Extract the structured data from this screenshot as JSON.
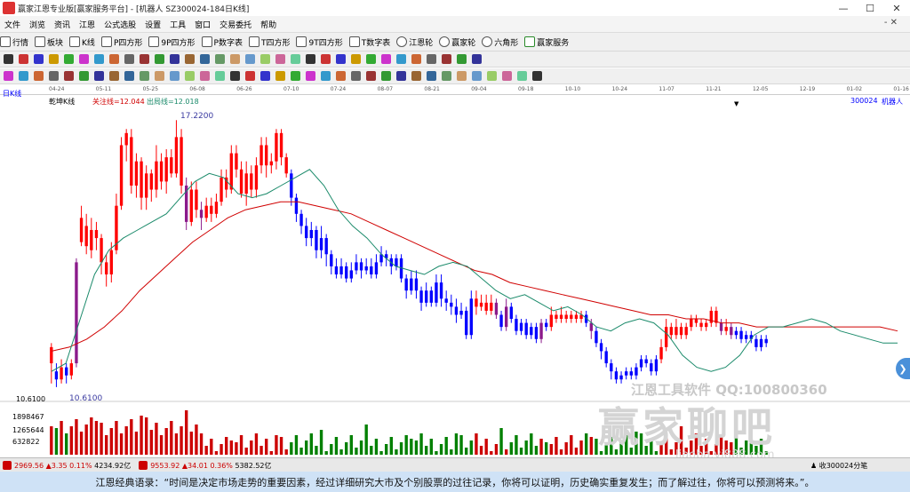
{
  "window": {
    "title": "赢家江恩专业版[赢家服务平台] - [机器人  SZ300024-184日K线]",
    "btn_min": "—",
    "btn_max": "☐",
    "btn_close": "✕"
  },
  "menu": {
    "items": [
      "文件",
      "浏览",
      "资讯",
      "江恩",
      "公式选股",
      "设置",
      "工具",
      "窗口",
      "交易委托",
      "帮助"
    ],
    "close_label": "- ✕"
  },
  "toolbar1": {
    "items": [
      "行情",
      "板块",
      "K线",
      "P四方形",
      "9P四方形",
      "P数字表",
      "T四方形",
      "9T四方形",
      "T数字表",
      "江恩轮",
      "赢家轮",
      "六角形",
      "赢家服务"
    ]
  },
  "date_axis": {
    "labels": [
      "04-24",
      "05-11",
      "05-25",
      "06-08",
      "06-26",
      "07-10",
      "07-24",
      "08-07",
      "08-21",
      "09-04",
      "09-18",
      "10-10",
      "10-24",
      "11-07",
      "11-21",
      "12-05",
      "12-19",
      "01-02",
      "01-16"
    ]
  },
  "chart_header": {
    "period": "日K线",
    "indicator": "乾坤K线",
    "line1": "关注线=12.044",
    "line2": "出局线=12.018",
    "stock": "300024",
    "stock_name": "机器人"
  },
  "price_labels": {
    "high": "17.2200",
    "low": "10.6100",
    "axis_low": "10.6100"
  },
  "volume_axis": {
    "labels": [
      "1898467",
      "1265644",
      "632822"
    ]
  },
  "statusbar": {
    "idx1_value": "2969.56",
    "idx1_change": "▲3.35",
    "idx1_pct": "0.11%",
    "idx1_amount": "4234.92亿",
    "idx2_value": "9553.92",
    "idx2_change": "▲34.01",
    "idx2_pct": "0.36%",
    "idx2_amount": "5382.52亿",
    "right_text": "收300024分笔"
  },
  "watermark": {
    "line1": "江恩工具软件  QQ:100800360",
    "line2": "赢家聊吧",
    "line3": "liaoba.yj888.com"
  },
  "bottom_quote": "江恩经典语录：“时间是决定市场走势的重要因素，经过详细研究大市及个别股票的过往记录，你将可以证明，历史确实重复发生；而了解过往，你将可以预测将来。”。",
  "colors": {
    "up": "#ff0000",
    "down": "#0000ff",
    "special": "#8b1a8b",
    "ma_red": "#d00000",
    "ma_green": "#1a8a6a",
    "vol_up": "#cc0000",
    "vol_down": "#008000"
  },
  "chart_data": {
    "type": "candlestick",
    "ylim": [
      10.3,
      17.6
    ],
    "candles": [
      {
        "o": 11.2,
        "c": 11.6,
        "h": 11.7,
        "l": 10.7,
        "t": "up"
      },
      {
        "o": 11.0,
        "c": 10.8,
        "h": 11.2,
        "l": 10.61,
        "t": "down"
      },
      {
        "o": 10.8,
        "c": 11.1,
        "h": 11.3,
        "l": 10.7,
        "t": "up"
      },
      {
        "o": 11.1,
        "c": 10.9,
        "h": 11.2,
        "l": 10.7,
        "t": "down"
      },
      {
        "o": 10.9,
        "c": 11.2,
        "h": 11.3,
        "l": 10.8,
        "t": "up"
      },
      {
        "o": 11.2,
        "c": 13.7,
        "h": 13.8,
        "l": 11.1,
        "t": "spec"
      },
      {
        "o": 14.2,
        "c": 14.8,
        "h": 15.1,
        "l": 14.1,
        "t": "up"
      },
      {
        "o": 14.6,
        "c": 14.1,
        "h": 14.9,
        "l": 13.9,
        "t": "up"
      },
      {
        "o": 14.0,
        "c": 14.5,
        "h": 14.8,
        "l": 13.8,
        "t": "up"
      },
      {
        "o": 14.5,
        "c": 14.3,
        "h": 14.7,
        "l": 14.0,
        "t": "up"
      },
      {
        "o": 14.3,
        "c": 13.7,
        "h": 14.4,
        "l": 13.4,
        "t": "up"
      },
      {
        "o": 13.7,
        "c": 13.4,
        "h": 13.9,
        "l": 13.1,
        "t": "up"
      },
      {
        "o": 13.4,
        "c": 14.0,
        "h": 14.2,
        "l": 13.2,
        "t": "up"
      },
      {
        "o": 14.0,
        "c": 15.1,
        "h": 15.4,
        "l": 13.9,
        "t": "up"
      },
      {
        "o": 15.1,
        "c": 16.6,
        "h": 16.8,
        "l": 15.0,
        "t": "up"
      },
      {
        "o": 16.6,
        "c": 16.9,
        "h": 17.0,
        "l": 16.2,
        "t": "up"
      },
      {
        "o": 16.8,
        "c": 15.6,
        "h": 17.0,
        "l": 15.4,
        "t": "up"
      },
      {
        "o": 15.6,
        "c": 16.2,
        "h": 16.4,
        "l": 15.3,
        "t": "up"
      },
      {
        "o": 16.2,
        "c": 15.3,
        "h": 16.3,
        "l": 15.0,
        "t": "up"
      },
      {
        "o": 15.3,
        "c": 15.9,
        "h": 16.1,
        "l": 15.0,
        "t": "up"
      },
      {
        "o": 15.9,
        "c": 15.5,
        "h": 16.0,
        "l": 15.2,
        "t": "up"
      },
      {
        "o": 15.5,
        "c": 16.2,
        "h": 16.6,
        "l": 15.3,
        "t": "up"
      },
      {
        "o": 16.2,
        "c": 15.7,
        "h": 16.4,
        "l": 15.5,
        "t": "up"
      },
      {
        "o": 15.7,
        "c": 16.3,
        "h": 16.5,
        "l": 15.4,
        "t": "up"
      },
      {
        "o": 16.3,
        "c": 15.9,
        "h": 16.5,
        "l": 15.8,
        "t": "up"
      },
      {
        "o": 15.9,
        "c": 16.8,
        "h": 17.22,
        "l": 15.8,
        "t": "up"
      },
      {
        "o": 16.8,
        "c": 15.6,
        "h": 17.0,
        "l": 15.4,
        "t": "up"
      },
      {
        "o": 15.6,
        "c": 14.7,
        "h": 15.8,
        "l": 14.5,
        "t": "spec"
      },
      {
        "o": 14.7,
        "c": 15.5,
        "h": 15.7,
        "l": 14.6,
        "t": "up"
      },
      {
        "o": 15.5,
        "c": 15.0,
        "h": 15.7,
        "l": 14.8,
        "t": "up"
      },
      {
        "o": 15.0,
        "c": 14.8,
        "h": 15.2,
        "l": 14.5,
        "t": "spec"
      },
      {
        "o": 14.8,
        "c": 15.1,
        "h": 15.3,
        "l": 14.7,
        "t": "up"
      },
      {
        "o": 15.1,
        "c": 14.9,
        "h": 15.3,
        "l": 14.7,
        "t": "up"
      },
      {
        "o": 14.9,
        "c": 15.2,
        "h": 15.4,
        "l": 14.8,
        "t": "up"
      },
      {
        "o": 15.2,
        "c": 15.8,
        "h": 16.0,
        "l": 15.1,
        "t": "up"
      },
      {
        "o": 15.8,
        "c": 15.5,
        "h": 16.0,
        "l": 15.3,
        "t": "up"
      },
      {
        "o": 15.5,
        "c": 16.4,
        "h": 16.6,
        "l": 15.4,
        "t": "up"
      },
      {
        "o": 16.4,
        "c": 16.0,
        "h": 16.6,
        "l": 15.8,
        "t": "up"
      },
      {
        "o": 16.0,
        "c": 15.4,
        "h": 16.2,
        "l": 15.3,
        "t": "up"
      },
      {
        "o": 15.4,
        "c": 15.9,
        "h": 16.2,
        "l": 15.1,
        "t": "up"
      },
      {
        "o": 15.9,
        "c": 15.5,
        "h": 16.1,
        "l": 15.3,
        "t": "up"
      },
      {
        "o": 15.5,
        "c": 16.1,
        "h": 16.3,
        "l": 15.3,
        "t": "up"
      },
      {
        "o": 16.1,
        "c": 16.6,
        "h": 16.8,
        "l": 15.9,
        "t": "up"
      },
      {
        "o": 16.6,
        "c": 16.1,
        "h": 16.8,
        "l": 15.8,
        "t": "up"
      },
      {
        "o": 16.1,
        "c": 16.2,
        "h": 16.4,
        "l": 15.9,
        "t": "up"
      },
      {
        "o": 16.2,
        "c": 16.9,
        "h": 17.0,
        "l": 16.0,
        "t": "up"
      },
      {
        "o": 16.9,
        "c": 16.3,
        "h": 17.0,
        "l": 16.1,
        "t": "up"
      },
      {
        "o": 16.3,
        "c": 15.9,
        "h": 16.4,
        "l": 15.8,
        "t": "up"
      },
      {
        "o": 15.9,
        "c": 15.3,
        "h": 16.0,
        "l": 15.1,
        "t": "down"
      },
      {
        "o": 15.3,
        "c": 14.9,
        "h": 15.4,
        "l": 14.7,
        "t": "down"
      },
      {
        "o": 14.9,
        "c": 14.6,
        "h": 15.0,
        "l": 14.4,
        "t": "down"
      },
      {
        "o": 14.6,
        "c": 14.3,
        "h": 14.8,
        "l": 14.1,
        "t": "down"
      },
      {
        "o": 14.3,
        "c": 14.5,
        "h": 14.7,
        "l": 14.1,
        "t": "down"
      },
      {
        "o": 14.5,
        "c": 14.0,
        "h": 14.6,
        "l": 13.8,
        "t": "down"
      },
      {
        "o": 14.0,
        "c": 14.3,
        "h": 14.6,
        "l": 13.8,
        "t": "down"
      },
      {
        "o": 14.3,
        "c": 13.9,
        "h": 14.4,
        "l": 13.6,
        "t": "down"
      },
      {
        "o": 13.9,
        "c": 13.6,
        "h": 14.0,
        "l": 13.4,
        "t": "down"
      },
      {
        "o": 13.6,
        "c": 13.4,
        "h": 13.8,
        "l": 13.3,
        "t": "down"
      },
      {
        "o": 13.4,
        "c": 13.6,
        "h": 13.8,
        "l": 13.3,
        "t": "down"
      },
      {
        "o": 13.6,
        "c": 13.3,
        "h": 13.7,
        "l": 13.2,
        "t": "down"
      },
      {
        "o": 13.3,
        "c": 13.5,
        "h": 13.7,
        "l": 13.2,
        "t": "down"
      },
      {
        "o": 13.5,
        "c": 13.7,
        "h": 13.9,
        "l": 13.4,
        "t": "down"
      },
      {
        "o": 13.7,
        "c": 13.5,
        "h": 13.8,
        "l": 13.3,
        "t": "down"
      },
      {
        "o": 13.5,
        "c": 13.6,
        "h": 13.8,
        "l": 13.4,
        "t": "down"
      },
      {
        "o": 13.6,
        "c": 13.4,
        "h": 13.8,
        "l": 13.3,
        "t": "down"
      },
      {
        "o": 13.4,
        "c": 13.7,
        "h": 13.9,
        "l": 13.3,
        "t": "down"
      },
      {
        "o": 13.7,
        "c": 13.9,
        "h": 14.1,
        "l": 13.6,
        "t": "down"
      },
      {
        "o": 13.9,
        "c": 13.8,
        "h": 14.0,
        "l": 13.6,
        "t": "down"
      },
      {
        "o": 13.8,
        "c": 13.6,
        "h": 13.9,
        "l": 13.4,
        "t": "down"
      },
      {
        "o": 13.6,
        "c": 13.8,
        "h": 13.9,
        "l": 13.5,
        "t": "down"
      },
      {
        "o": 13.8,
        "c": 13.3,
        "h": 13.9,
        "l": 13.2,
        "t": "down"
      },
      {
        "o": 13.3,
        "c": 13.0,
        "h": 13.4,
        "l": 12.8,
        "t": "down"
      },
      {
        "o": 13.0,
        "c": 13.3,
        "h": 13.5,
        "l": 12.9,
        "t": "down"
      },
      {
        "o": 13.3,
        "c": 13.0,
        "h": 13.5,
        "l": 12.8,
        "t": "down"
      },
      {
        "o": 13.0,
        "c": 12.7,
        "h": 13.1,
        "l": 12.5,
        "t": "down"
      },
      {
        "o": 12.7,
        "c": 13.0,
        "h": 13.2,
        "l": 12.6,
        "t": "down"
      },
      {
        "o": 13.0,
        "c": 12.7,
        "h": 13.1,
        "l": 12.6,
        "t": "down"
      },
      {
        "o": 12.7,
        "c": 13.2,
        "h": 13.4,
        "l": 12.6,
        "t": "down"
      },
      {
        "o": 13.2,
        "c": 12.8,
        "h": 13.4,
        "l": 12.6,
        "t": "down"
      },
      {
        "o": 12.8,
        "c": 12.7,
        "h": 13.0,
        "l": 12.5,
        "t": "down"
      },
      {
        "o": 12.7,
        "c": 12.6,
        "h": 12.9,
        "l": 12.4,
        "t": "down"
      },
      {
        "o": 12.6,
        "c": 12.4,
        "h": 12.8,
        "l": 12.2,
        "t": "down"
      },
      {
        "o": 12.4,
        "c": 12.5,
        "h": 12.7,
        "l": 12.3,
        "t": "down"
      },
      {
        "o": 12.5,
        "c": 11.9,
        "h": 12.6,
        "l": 11.8,
        "t": "down"
      },
      {
        "o": 11.9,
        "c": 12.8,
        "h": 13.0,
        "l": 11.8,
        "t": "down"
      },
      {
        "o": 12.8,
        "c": 12.6,
        "h": 13.0,
        "l": 12.4,
        "t": "up"
      },
      {
        "o": 12.6,
        "c": 12.7,
        "h": 12.9,
        "l": 12.5,
        "t": "up"
      },
      {
        "o": 12.7,
        "c": 12.5,
        "h": 12.9,
        "l": 12.4,
        "t": "up"
      },
      {
        "o": 12.5,
        "c": 12.7,
        "h": 12.9,
        "l": 12.4,
        "t": "up"
      },
      {
        "o": 12.7,
        "c": 12.4,
        "h": 12.8,
        "l": 12.3,
        "t": "spec"
      },
      {
        "o": 12.4,
        "c": 12.1,
        "h": 12.5,
        "l": 12.0,
        "t": "down"
      },
      {
        "o": 12.1,
        "c": 12.6,
        "h": 12.8,
        "l": 12.0,
        "t": "spec"
      },
      {
        "o": 12.6,
        "c": 12.3,
        "h": 12.7,
        "l": 12.2,
        "t": "down"
      },
      {
        "o": 12.3,
        "c": 12.0,
        "h": 12.4,
        "l": 11.9,
        "t": "down"
      },
      {
        "o": 12.0,
        "c": 12.2,
        "h": 12.3,
        "l": 11.9,
        "t": "down"
      },
      {
        "o": 12.2,
        "c": 11.9,
        "h": 12.3,
        "l": 11.8,
        "t": "down"
      },
      {
        "o": 11.9,
        "c": 12.1,
        "h": 12.2,
        "l": 11.8,
        "t": "down"
      },
      {
        "o": 12.1,
        "c": 11.8,
        "h": 12.2,
        "l": 11.7,
        "t": "down"
      },
      {
        "o": 11.8,
        "c": 12.2,
        "h": 12.3,
        "l": 11.7,
        "t": "spec"
      },
      {
        "o": 12.2,
        "c": 12.1,
        "h": 12.3,
        "l": 12.0,
        "t": "down"
      },
      {
        "o": 12.1,
        "c": 12.4,
        "h": 12.6,
        "l": 12.0,
        "t": "up"
      },
      {
        "o": 12.4,
        "c": 12.3,
        "h": 12.5,
        "l": 12.2,
        "t": "up"
      },
      {
        "o": 12.3,
        "c": 12.4,
        "h": 12.6,
        "l": 12.2,
        "t": "up"
      },
      {
        "o": 12.4,
        "c": 12.3,
        "h": 12.5,
        "l": 12.2,
        "t": "up"
      },
      {
        "o": 12.3,
        "c": 12.4,
        "h": 12.5,
        "l": 12.2,
        "t": "up"
      },
      {
        "o": 12.4,
        "c": 12.3,
        "h": 12.5,
        "l": 12.2,
        "t": "up"
      },
      {
        "o": 12.3,
        "c": 12.4,
        "h": 12.5,
        "l": 12.2,
        "t": "up"
      },
      {
        "o": 12.4,
        "c": 12.2,
        "h": 12.5,
        "l": 12.1,
        "t": "down"
      },
      {
        "o": 12.2,
        "c": 12.0,
        "h": 12.3,
        "l": 11.8,
        "t": "spec"
      },
      {
        "o": 12.0,
        "c": 11.7,
        "h": 12.1,
        "l": 11.6,
        "t": "down"
      },
      {
        "o": 11.7,
        "c": 11.5,
        "h": 11.8,
        "l": 11.3,
        "t": "down"
      },
      {
        "o": 11.5,
        "c": 11.2,
        "h": 11.6,
        "l": 11.1,
        "t": "down"
      },
      {
        "o": 11.2,
        "c": 11.0,
        "h": 11.3,
        "l": 10.8,
        "t": "down"
      },
      {
        "o": 11.0,
        "c": 10.8,
        "h": 11.1,
        "l": 10.7,
        "t": "down"
      },
      {
        "o": 10.8,
        "c": 10.9,
        "h": 11.0,
        "l": 10.7,
        "t": "down"
      },
      {
        "o": 10.9,
        "c": 11.0,
        "h": 11.1,
        "l": 10.8,
        "t": "down"
      },
      {
        "o": 11.0,
        "c": 10.9,
        "h": 11.1,
        "l": 10.8,
        "t": "down"
      },
      {
        "o": 10.9,
        "c": 11.1,
        "h": 11.2,
        "l": 10.8,
        "t": "down"
      },
      {
        "o": 11.1,
        "c": 11.3,
        "h": 11.4,
        "l": 11.0,
        "t": "down"
      },
      {
        "o": 11.3,
        "c": 11.2,
        "h": 11.4,
        "l": 11.1,
        "t": "down"
      },
      {
        "o": 11.2,
        "c": 11.0,
        "h": 11.3,
        "l": 10.9,
        "t": "down"
      },
      {
        "o": 11.0,
        "c": 11.3,
        "h": 11.4,
        "l": 10.9,
        "t": "down"
      },
      {
        "o": 11.3,
        "c": 11.6,
        "h": 11.8,
        "l": 11.2,
        "t": "up"
      },
      {
        "o": 11.6,
        "c": 12.1,
        "h": 12.3,
        "l": 11.5,
        "t": "up"
      },
      {
        "o": 12.1,
        "c": 11.9,
        "h": 12.2,
        "l": 11.8,
        "t": "up"
      },
      {
        "o": 11.9,
        "c": 12.1,
        "h": 12.3,
        "l": 11.8,
        "t": "up"
      },
      {
        "o": 12.1,
        "c": 11.9,
        "h": 12.2,
        "l": 11.8,
        "t": "up"
      },
      {
        "o": 11.9,
        "c": 12.1,
        "h": 12.2,
        "l": 11.8,
        "t": "up"
      },
      {
        "o": 12.1,
        "c": 12.3,
        "h": 12.4,
        "l": 12.0,
        "t": "up"
      },
      {
        "o": 12.3,
        "c": 12.2,
        "h": 12.4,
        "l": 12.1,
        "t": "up"
      },
      {
        "o": 12.2,
        "c": 12.1,
        "h": 12.3,
        "l": 12.0,
        "t": "up"
      },
      {
        "o": 12.1,
        "c": 12.2,
        "h": 12.3,
        "l": 12.0,
        "t": "up"
      },
      {
        "o": 12.2,
        "c": 12.5,
        "h": 12.6,
        "l": 12.1,
        "t": "up"
      },
      {
        "o": 12.5,
        "c": 12.2,
        "h": 12.6,
        "l": 12.1,
        "t": "up"
      },
      {
        "o": 12.2,
        "c": 12.0,
        "h": 12.3,
        "l": 11.9,
        "t": "spec"
      },
      {
        "o": 12.0,
        "c": 12.1,
        "h": 12.3,
        "l": 11.9,
        "t": "up"
      },
      {
        "o": 12.1,
        "c": 11.9,
        "h": 12.2,
        "l": 11.8,
        "t": "spec"
      },
      {
        "o": 11.9,
        "c": 12.0,
        "h": 12.1,
        "l": 11.8,
        "t": "down"
      },
      {
        "o": 12.0,
        "c": 11.8,
        "h": 12.1,
        "l": 11.7,
        "t": "down"
      },
      {
        "o": 11.8,
        "c": 11.9,
        "h": 12.0,
        "l": 11.7,
        "t": "down"
      },
      {
        "o": 11.9,
        "c": 11.8,
        "h": 12.0,
        "l": 11.7,
        "t": "down"
      },
      {
        "o": 11.8,
        "c": 11.6,
        "h": 11.9,
        "l": 11.5,
        "t": "down"
      },
      {
        "o": 11.6,
        "c": 11.8,
        "h": 11.9,
        "l": 11.5,
        "t": "down"
      },
      {
        "o": 11.8,
        "c": 11.7,
        "h": 11.9,
        "l": 11.6,
        "t": "down"
      }
    ],
    "ma_red": [
      11.5,
      11.6,
      11.8,
      12.1,
      12.5,
      13.0,
      13.4,
      13.8,
      14.2,
      14.5,
      14.8,
      15.0,
      15.1,
      15.2,
      15.2,
      15.1,
      15.0,
      14.9,
      14.7,
      14.5,
      14.3,
      14.1,
      13.9,
      13.7,
      13.5,
      13.4,
      13.2,
      13.1,
      13.0,
      12.9,
      12.8,
      12.7,
      12.6,
      12.5,
      12.4,
      12.4,
      12.3,
      12.3,
      12.2,
      12.2,
      12.1,
      12.1,
      12.1,
      12.1,
      12.1,
      12.1,
      12.1,
      12.1,
      12.0
    ],
    "ma_green": [
      11.0,
      11.2,
      12.3,
      13.4,
      14.0,
      14.3,
      14.5,
      14.7,
      14.9,
      15.3,
      15.7,
      15.9,
      15.8,
      15.4,
      15.3,
      15.4,
      15.6,
      15.8,
      16.0,
      15.6,
      15.0,
      14.6,
      14.3,
      13.9,
      13.6,
      13.5,
      13.4,
      13.6,
      13.7,
      13.6,
      13.3,
      13.0,
      12.8,
      12.9,
      12.7,
      12.5,
      12.6,
      12.4,
      12.1,
      12.0,
      12.2,
      12.3,
      12.2,
      11.9,
      11.4,
      11.1,
      11.0,
      11.1,
      11.4,
      11.9,
      12.1,
      12.1,
      12.2,
      12.3,
      12.2,
      12.0,
      11.9,
      11.8,
      11.7,
      11.7
    ]
  }
}
